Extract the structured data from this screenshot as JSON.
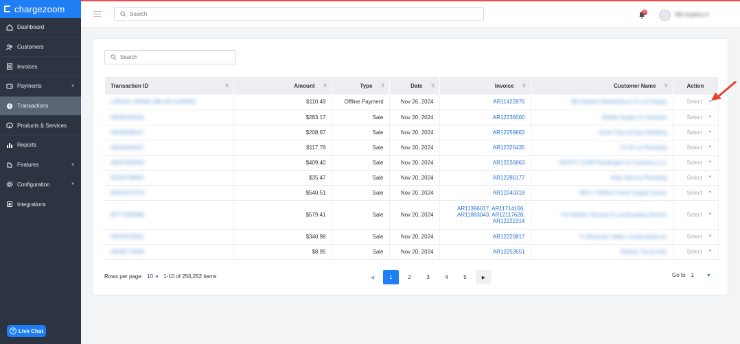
{
  "brand": {
    "name": "chargezoom"
  },
  "sidebar": {
    "items": [
      {
        "label": "Dashboard",
        "icon": "home-icon",
        "expandable": false,
        "active": false
      },
      {
        "label": "Customers",
        "icon": "users-icon",
        "expandable": false,
        "active": false
      },
      {
        "label": "Invoices",
        "icon": "invoice-icon",
        "expandable": false,
        "active": false
      },
      {
        "label": "Payments",
        "icon": "wallet-icon",
        "expandable": true,
        "active": false
      },
      {
        "label": "Transactions",
        "icon": "transactions-icon",
        "expandable": false,
        "active": true
      },
      {
        "label": "Products & Services",
        "icon": "box-icon",
        "expandable": false,
        "active": false
      },
      {
        "label": "Reports",
        "icon": "chart-icon",
        "expandable": false,
        "active": false
      },
      {
        "label": "Features",
        "icon": "puzzle-icon",
        "expandable": true,
        "active": false
      },
      {
        "label": "Configuration",
        "icon": "gear-icon",
        "expandable": true,
        "active": false
      },
      {
        "label": "Integrations",
        "icon": "integration-icon",
        "expandable": false,
        "active": false
      }
    ],
    "live_chat": "Live Chat"
  },
  "topbar": {
    "search_placeholder": "Search",
    "notification_count": "30",
    "username": "Bill Hopkins ▾"
  },
  "transactions": {
    "search_placeholder": "Search",
    "columns": [
      "Transaction ID",
      "Amount",
      "Type",
      "Date",
      "Invoice",
      "Customer Name",
      "Action"
    ],
    "rows": [
      {
        "id": "c1f5026 c30f9d0 d8b 0d5 b1f0f58d",
        "amount": "$110.49",
        "type": "Offline Payment",
        "date": "Nov 26, 2024",
        "invoice": "AR11422876",
        "customer": "Bill Hopkins Marketing & Co Ltd Supply",
        "action": "Select"
      },
      {
        "id": "40091569416",
        "amount": "$283.17",
        "type": "Sale",
        "date": "Nov 20, 2024",
        "invoice": "AR12236000",
        "customer": "Mobile Supply Co Network",
        "action": "Select"
      },
      {
        "id": "40056938317",
        "amount": "$208.67",
        "type": "Sale",
        "date": "Nov 20, 2024",
        "invoice": "AR12259863",
        "customer": "Jones Tires & Auto Detailing",
        "action": "Select"
      },
      {
        "id": "40056393047",
        "amount": "$117.78",
        "type": "Sale",
        "date": "Nov 20, 2024",
        "invoice": "AR12326435",
        "customer": "J & M Lot Plumbing",
        "action": "Select"
      },
      {
        "id": "40057835833",
        "amount": "$409.40",
        "type": "Sale",
        "date": "Nov 20, 2024",
        "invoice": "AR12236863",
        "customer": "DEPOT CORP Readington & Company LLC",
        "action": "Select"
      },
      {
        "id": "40054769087",
        "amount": "$35.47",
        "type": "Sale",
        "date": "Nov 20, 2024",
        "invoice": "AR12286177",
        "customer": "Kelly Service Plumbing",
        "action": "Select"
      },
      {
        "id": "40061976753",
        "amount": "$540.51",
        "type": "Sale",
        "date": "Nov 20, 2024",
        "invoice": "AR12240318",
        "customer": "Bill & J Wilson Home Supply Goods",
        "action": "Select"
      },
      {
        "id": "40772296488",
        "amount": "$579.41",
        "type": "Sale",
        "date": "Nov 20, 2024",
        "invoice": "AR11396017, AR11714166, AR11883043, AR12117628, AR12222314",
        "customer": "Pro Builder Nursery & Landscaping Service",
        "action": "Select",
        "tall": true
      },
      {
        "id": "40055975051",
        "amount": "$340.98",
        "type": "Sale",
        "date": "Nov 20, 2024",
        "invoice": "AR12220817",
        "customer": "Tri Mountain Valley Landscaping Inc",
        "action": "Select"
      },
      {
        "id": "40056775089",
        "amount": "$8.95",
        "type": "Sale",
        "date": "Nov 20, 2024",
        "invoice": "AR12253651",
        "customer": "Stanley Tire & Auto",
        "action": "Select"
      }
    ]
  },
  "pagination": {
    "rows_label": "Rows per page:",
    "rows_value": "10",
    "range": "1-10 of 256,252  items",
    "pages": [
      "1",
      "2",
      "3",
      "4",
      "5"
    ],
    "current_page": "1",
    "goto_label": "Go to",
    "goto_value": "1"
  },
  "colors": {
    "accent": "#1f7ef5",
    "sidebar": "#2b3440",
    "annotation_arrow": "#e8402f"
  }
}
